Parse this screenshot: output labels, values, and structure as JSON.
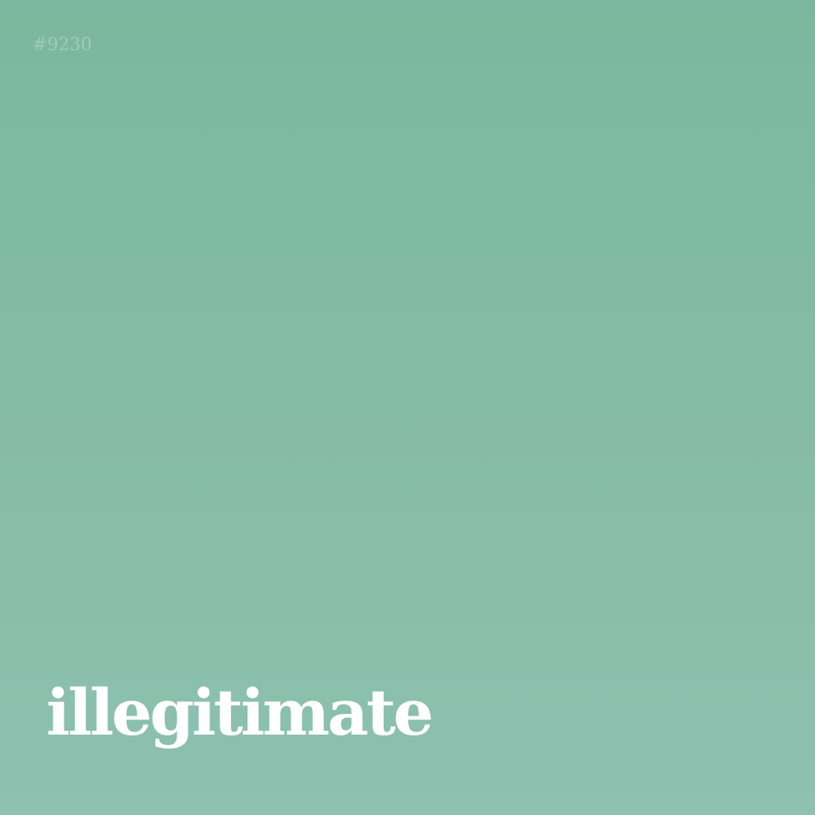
{
  "card": {
    "id": "#9230",
    "word": "illegitimate"
  },
  "colors": {
    "background_top": "#7bb79e",
    "background_bottom": "#8dc1b0",
    "word_text": "#ffffff"
  }
}
